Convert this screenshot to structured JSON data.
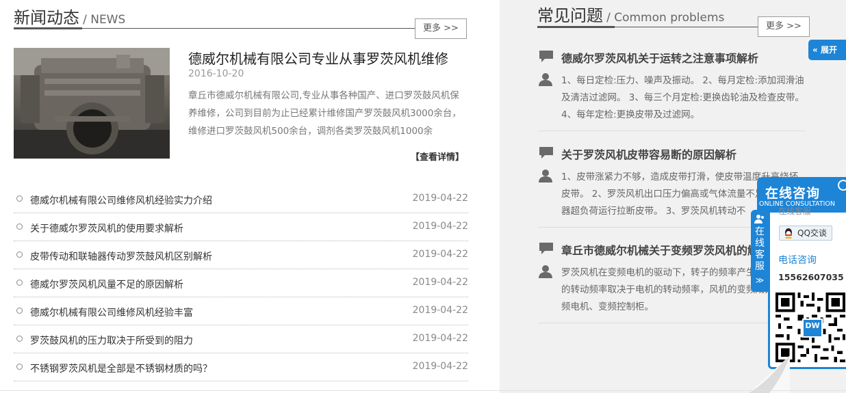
{
  "news": {
    "title_cn": "新闻动态",
    "title_en": "/ NEWS",
    "more_label": "更多 >>",
    "featured": {
      "title": "德威尔机械有限公司专业从事罗茨风机维修",
      "date": "2016-10-20",
      "description": "章丘市德威尔机械有限公司,专业从事各种国产、进口罗茨鼓风机保养维修，公司到目前为止已经累计维修国产罗茨鼓风机3000余台，维修进口罗茨鼓风机500余台，调剂各类罗茨鼓风机1000余",
      "detail_link": "【查看详情】"
    },
    "items": [
      {
        "title": "德威尔机械有限公司维修风机经验实力介绍",
        "date": "2019-04-22"
      },
      {
        "title": "关于德威尔罗茨风机的使用要求解析",
        "date": "2019-04-22"
      },
      {
        "title": "皮带传动和联轴器传动罗茨鼓风机区别解析",
        "date": "2019-04-22"
      },
      {
        "title": "德威尔罗茨风机风量不足的原因解析",
        "date": "2019-04-22"
      },
      {
        "title": "德威尔机械有限公司维修风机经验丰富",
        "date": "2019-04-22"
      },
      {
        "title": "罗茨鼓风机的压力取决于所受到的阻力",
        "date": "2019-04-22"
      },
      {
        "title": "不锈钢罗茨风机是全部是不锈钢材质的吗？",
        "date": "2019-04-22"
      }
    ]
  },
  "faq": {
    "title_cn": "常见问题",
    "title_en": "/ Common problems",
    "more_label": "更多 >>",
    "items": [
      {
        "question": "德威尔罗茨风机关于运转之注意事项解析",
        "answer": "1、每日定检:压力、噪声及振动。 2、每月定检:添加润滑油及清洁过滤网。 3、每三个月定检:更换齿轮油及检查皮带。 4、每年定检:更换皮带及过滤网。"
      },
      {
        "question": "关于罗茨风机皮带容易断的原因解析",
        "answer": "1、皮带涨紧力不够，造成皮带打滑，使皮带温度升高烧坏皮带。 2、罗茨风机出口压力偏高或气体流量不足，造成机器超负荷运行拉断皮带。 3、罗茨风机转动不"
      },
      {
        "question": "章丘市德威尔机械关于变频罗茨风机的解析",
        "answer": "罗茨风机在变频电机的驱动下，转子的频率产生转变，风机的转动频率取决于电机的转动频率，风机的变频成分是：变频电机、变频控制柜。"
      }
    ]
  },
  "widget": {
    "expand_label": "展开",
    "consult_cn": "在线咨询",
    "consult_en": "ONLINE CONSULTATION",
    "side_tab_label": "在线客服",
    "side_tab_arrow": "≫",
    "online_service": "在线客服",
    "qq_label": "QQ交谈",
    "phone_label": "电话咨询",
    "phone_number": "15562607035",
    "qr_badge": "DW",
    "accent_color": "#1d84d6"
  }
}
